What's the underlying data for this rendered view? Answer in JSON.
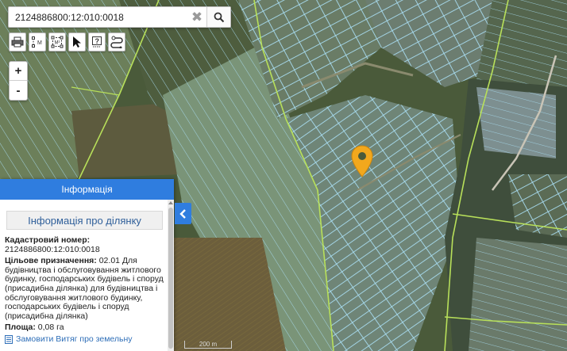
{
  "search": {
    "value": "2124886800:12:010:0018"
  },
  "toolbar": {
    "tools": [
      {
        "icon": "printer-icon",
        "label": ""
      },
      {
        "icon": "measure-distance-icon",
        "label": "M"
      },
      {
        "icon": "measure-area-icon",
        "label": "M²"
      },
      {
        "icon": "cursor-icon",
        "label": ""
      },
      {
        "icon": "help-icon",
        "label": "?"
      },
      {
        "icon": "route-icon",
        "label": ""
      }
    ]
  },
  "zoom": {
    "in_label": "+",
    "out_label": "-"
  },
  "panel": {
    "header": "Інформація",
    "subtitle": "Інформація про ділянку",
    "cadastral_label": "Кадастровий номер:",
    "cadastral_value": "2124886800:12:010:0018",
    "purpose_label": "Цільове призначення:",
    "purpose_value": "02.01 Для будівництва і обслуговування житлового будинку, господарських будівель і споруд (присадибна ділянка) для будівництва і обслуговування житлового будинку, господарських будівель і споруд (присадибна ділянка)",
    "area_label": "Площа:",
    "area_value": "0,08 га",
    "order_link": "Замовити Витяг про земельну"
  },
  "map": {
    "scale_label": "200 m",
    "marker_color": "#f2a81d",
    "parcel_line_color": "#a8dcf0",
    "boundary_color": "#b8e05a"
  }
}
